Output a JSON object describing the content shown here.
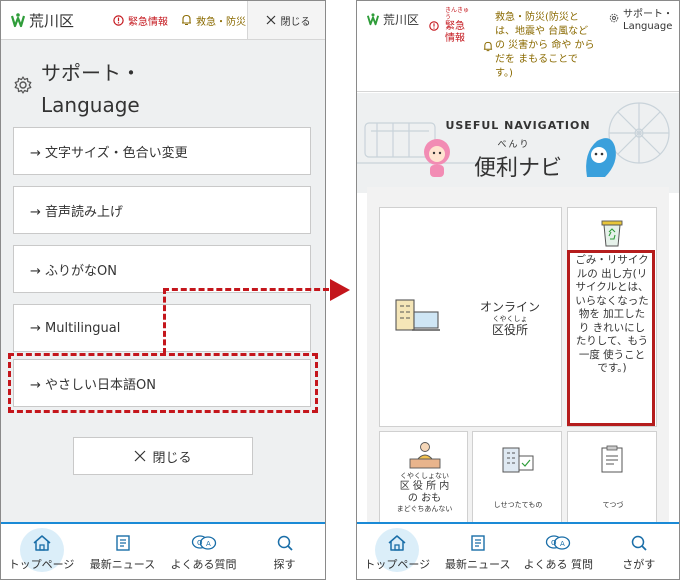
{
  "left": {
    "header": {
      "logo_text": "荒川区",
      "emergency_label": "緊急情報",
      "disaster_label": "救急・防災",
      "close_label": "閉じる"
    },
    "menu": {
      "title_line1": "サポート・",
      "title_line2": "Language",
      "items": [
        "→ 文字サイズ・色合い変更",
        "→ 音声読み上げ",
        "→ ふりがなON",
        "→ Multilingual",
        "→ やさしい日本語ON"
      ],
      "close_button": "閉じる"
    },
    "tabbar": [
      "トップページ",
      "最新ニュース",
      "よくある質問",
      "探す"
    ]
  },
  "right": {
    "header": {
      "logo_text": "荒川区",
      "emergency_ruby": "きんきゅう",
      "emergency_label": "緊急",
      "emergency_label2": "情報",
      "disaster_line1": "救急・防災(防災と",
      "disaster_line2": "は、地震や 台風など",
      "disaster_line3": "の 災害から 命や から",
      "disaster_line4": "だを まもることで",
      "disaster_line5": "す。)",
      "support_line1": "サポート・",
      "support_line2": "Language"
    },
    "nav": {
      "heading": "USEFUL NAVIGATION",
      "title_ruby": "べんり",
      "title": "便利ナビ"
    },
    "cards": {
      "online_line1": "オンライン",
      "online_ruby": "くやくしょ",
      "online_line2": "区役所",
      "garbage_lines": [
        "ごみ・リサイク",
        "ルの 出し方(リ",
        "サイクルとは、",
        "いらなくなった",
        "物を 加工した",
        "り きれいにし",
        "たりして、もう",
        "一度 使うこと",
        "です。)"
      ],
      "ward_line1": "くやくしょない",
      "ward_line2": "区 役 所 内",
      "ward_line3": "の おも",
      "ward_line4": "まどぐちあんない",
      "procedure_label": "しせつたてもの",
      "forms_label": "てつづ"
    },
    "tabbar": [
      "トップページ",
      "最新ニュース",
      "よくある 質問",
      "さがす"
    ]
  },
  "colors": {
    "accent_red": "#c4161c",
    "tab_border_blue": "#1a8ad6",
    "logo_green": "#2f9d3a"
  }
}
